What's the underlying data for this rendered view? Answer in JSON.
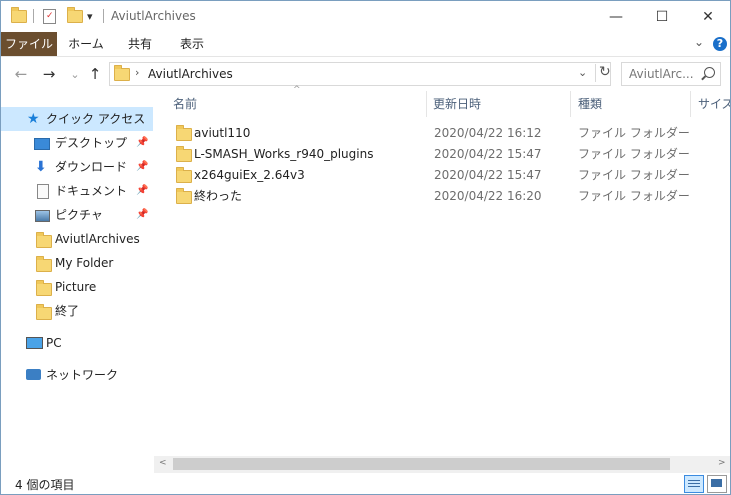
{
  "window": {
    "title": "AviutlArchives",
    "minimize_glyph": "—",
    "maximize_glyph": "☐",
    "close_glyph": "✕"
  },
  "quick_access_toolbar": {
    "dropdown_glyph": "▾"
  },
  "ribbon": {
    "tabs": [
      "ファイル",
      "ホーム",
      "共有",
      "表示"
    ],
    "collapse_glyph": "⌄",
    "help_glyph": "?"
  },
  "navigation": {
    "back_glyph": "←",
    "forward_glyph": "→",
    "recent_glyph": "⌄",
    "up_glyph": "↑",
    "address_chevron": "›",
    "address_path": "AviutlArchives",
    "address_dropdown_glyph": "⌄",
    "refresh_glyph": "↻",
    "search_placeholder": "AviutlArc..."
  },
  "nav_pane": {
    "quick_access": "クイック アクセス",
    "items": [
      {
        "label": "デスクトップ",
        "icon": "desktop-icon",
        "pinned": true
      },
      {
        "label": "ダウンロード",
        "icon": "download-icon",
        "pinned": true
      },
      {
        "label": "ドキュメント",
        "icon": "documents-icon",
        "pinned": true
      },
      {
        "label": "ピクチャ",
        "icon": "pictures-icon",
        "pinned": true
      },
      {
        "label": "AviutlArchives",
        "icon": "folder-icon",
        "pinned": false
      },
      {
        "label": "My Folder",
        "icon": "folder-icon",
        "pinned": false
      },
      {
        "label": "Picture",
        "icon": "folder-icon",
        "pinned": false
      },
      {
        "label": "終了",
        "icon": "folder-icon",
        "pinned": false
      }
    ],
    "pin_glyph": "📌",
    "pc": "PC",
    "network": "ネットワーク"
  },
  "file_list": {
    "columns": [
      "名前",
      "更新日時",
      "種類",
      "サイズ"
    ],
    "sort_glyph": "^",
    "rows": [
      {
        "name": "aviutl110",
        "date": "2020/04/22 16:12",
        "type": "ファイル フォルダー"
      },
      {
        "name": "L-SMASH_Works_r940_plugins",
        "date": "2020/04/22 15:47",
        "type": "ファイル フォルダー"
      },
      {
        "name": "x264guiEx_2.64v3",
        "date": "2020/04/22 15:47",
        "type": "ファイル フォルダー"
      },
      {
        "name": "終わった",
        "date": "2020/04/22 16:20",
        "type": "ファイル フォルダー"
      }
    ]
  },
  "scrollbar": {
    "left_glyph": "<",
    "right_glyph": ">"
  },
  "status_bar": {
    "item_count": "4 個の項目"
  },
  "colors": {
    "file_tab": "#6b4e2f",
    "selection": "#cce8ff",
    "folder": "#f7d774",
    "accent": "#1a6fc9"
  }
}
